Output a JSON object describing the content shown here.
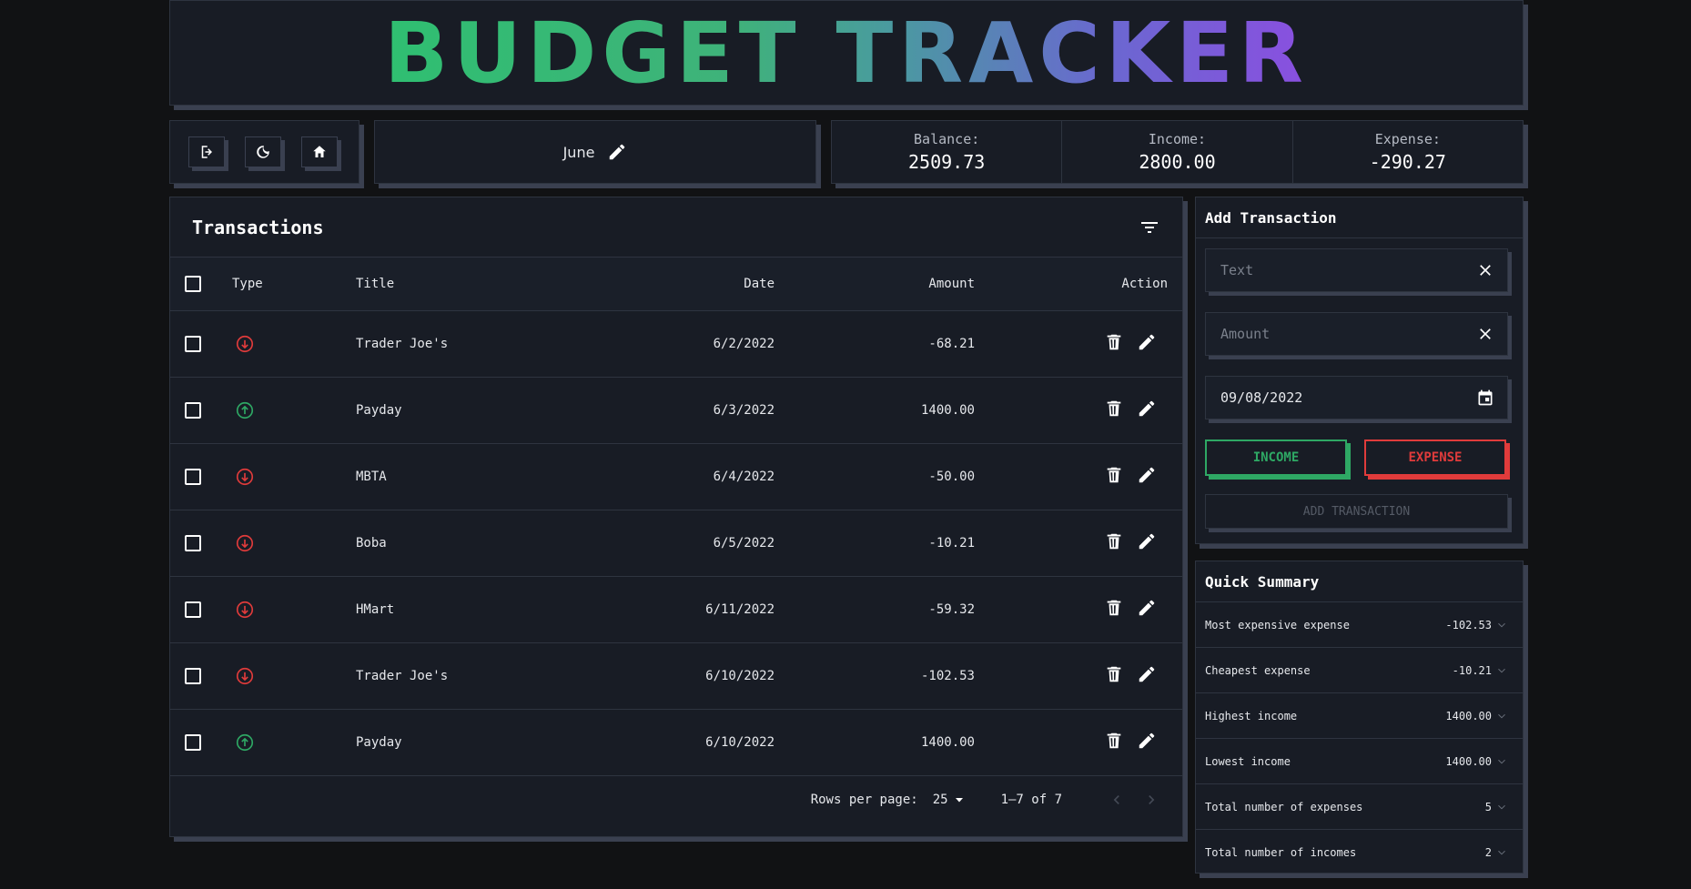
{
  "app": {
    "title": "BUDGET TRACKER",
    "title_gradient": [
      "#2fbf71",
      "#4aa09a",
      "#6a6ad0",
      "#8a4fe0"
    ]
  },
  "toolbar": {
    "buttons": [
      {
        "icon": "logout-icon"
      },
      {
        "icon": "moon-icon"
      },
      {
        "icon": "home-icon"
      }
    ]
  },
  "month": {
    "label": "June",
    "icon": "pencil-icon"
  },
  "stats": {
    "balance_label": "Balance:",
    "balance_value": "2509.73",
    "income_label": "Income:",
    "income_value": "2800.00",
    "expense_label": "Expense:",
    "expense_value": "-290.27"
  },
  "transactions": {
    "title": "Transactions",
    "filter_icon": "filter-icon",
    "columns": [
      "Type",
      "Title",
      "Date",
      "Amount",
      "Action"
    ],
    "rows": [
      {
        "type": "expense",
        "title": "Trader Joe's",
        "date": "6/2/2022",
        "amount": "-68.21"
      },
      {
        "type": "income",
        "title": "Payday",
        "date": "6/3/2022",
        "amount": "1400.00"
      },
      {
        "type": "expense",
        "title": "MBTA",
        "date": "6/4/2022",
        "amount": "-50.00"
      },
      {
        "type": "expense",
        "title": "Boba",
        "date": "6/5/2022",
        "amount": "-10.21"
      },
      {
        "type": "expense",
        "title": "HMart",
        "date": "6/11/2022",
        "amount": "-59.32"
      },
      {
        "type": "expense",
        "title": "Trader Joe's",
        "date": "6/10/2022",
        "amount": "-102.53"
      },
      {
        "type": "income",
        "title": "Payday",
        "date": "6/10/2022",
        "amount": "1400.00"
      }
    ],
    "pagination": {
      "rows_per_page_label": "Rows per page:",
      "rows_per_page": "25",
      "range": "1–7 of 7"
    }
  },
  "add_transaction": {
    "title": "Add Transaction",
    "text_placeholder": "Text",
    "amount_placeholder": "Amount",
    "date_value": "09/08/2022",
    "income_label": "INCOME",
    "expense_label": "EXPENSE",
    "submit_label": "ADD TRANSACTION"
  },
  "summary": {
    "title": "Quick Summary",
    "rows": [
      {
        "label": "Most expensive expense",
        "value": "-102.53"
      },
      {
        "label": "Cheapest expense",
        "value": "-10.21"
      },
      {
        "label": "Highest income",
        "value": "1400.00"
      },
      {
        "label": "Lowest income",
        "value": "1400.00"
      },
      {
        "label": "Total number of expenses",
        "value": "5"
      },
      {
        "label": "Total number of incomes",
        "value": "2"
      }
    ]
  },
  "colors": {
    "income": "#2ea864",
    "expense": "#e03b3b",
    "background": "#111214",
    "panel": "#181c25"
  }
}
